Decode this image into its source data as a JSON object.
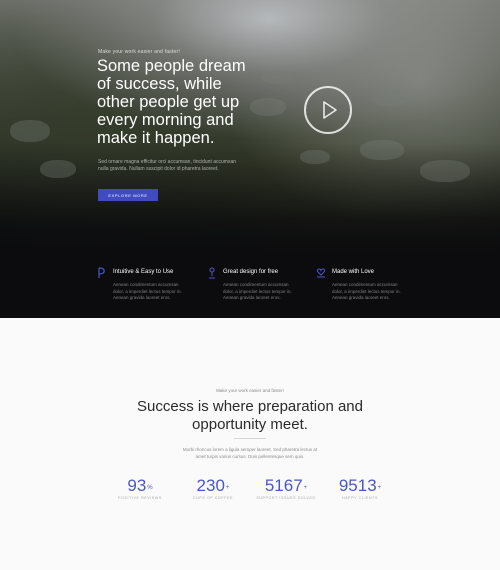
{
  "hero": {
    "eyebrow": "Make your work easier and faster!",
    "title": "Some people dream\nof success, while\nother people get up\nevery morning and\nmake it happen.",
    "paragraph": "Sed ornare magna efficitur orci accumsan, tincidunt accumsan\nnulla gravida. Nullam suscipit dolor id pharetra laoreet.",
    "button_label": "EXPLORE MORE",
    "accent_color": "#3f4bbf"
  },
  "features": [
    {
      "icon": "pen-nib-icon",
      "title": "Intuitive & Easy to Use",
      "text": "Aenean condimentum accumsan dolor, a imperdiet lectus tempor in. Aenean gravida laoreet eros."
    },
    {
      "icon": "person-pin-icon",
      "title": "Great design for free",
      "text": "Aenean condimentum accumsan dolor, a imperdiet lectus tempor in. Aenean gravida laoreet eros."
    },
    {
      "icon": "heart-hand-icon",
      "title": "Made with Love",
      "text": "Aenean condimentum accumsan dolor, a imperdiet lectus tempor in. Aenean gravida laoreet eros."
    }
  ],
  "section": {
    "eyebrow": "Make your work easier and faster!",
    "title": "Success is where preparation and\nopportunity meet.",
    "paragraph": "Morbi rhoncus lorem a ligula semper laoreet. Sed pharetra lectus at\namet turpis varius cursus. Duis pellentesque sem quis."
  },
  "stats": [
    {
      "value": "93",
      "suffix": "%",
      "label": "POSITIVE REVIEWS"
    },
    {
      "value": "230",
      "suffix": "+",
      "label": "CUPS OF COFFEE"
    },
    {
      "value": "5167",
      "suffix": "+",
      "label": "SUPPORT ISSUES SOLVED"
    },
    {
      "value": "9513",
      "suffix": "+",
      "label": "HAPPY CLIENTS"
    }
  ]
}
